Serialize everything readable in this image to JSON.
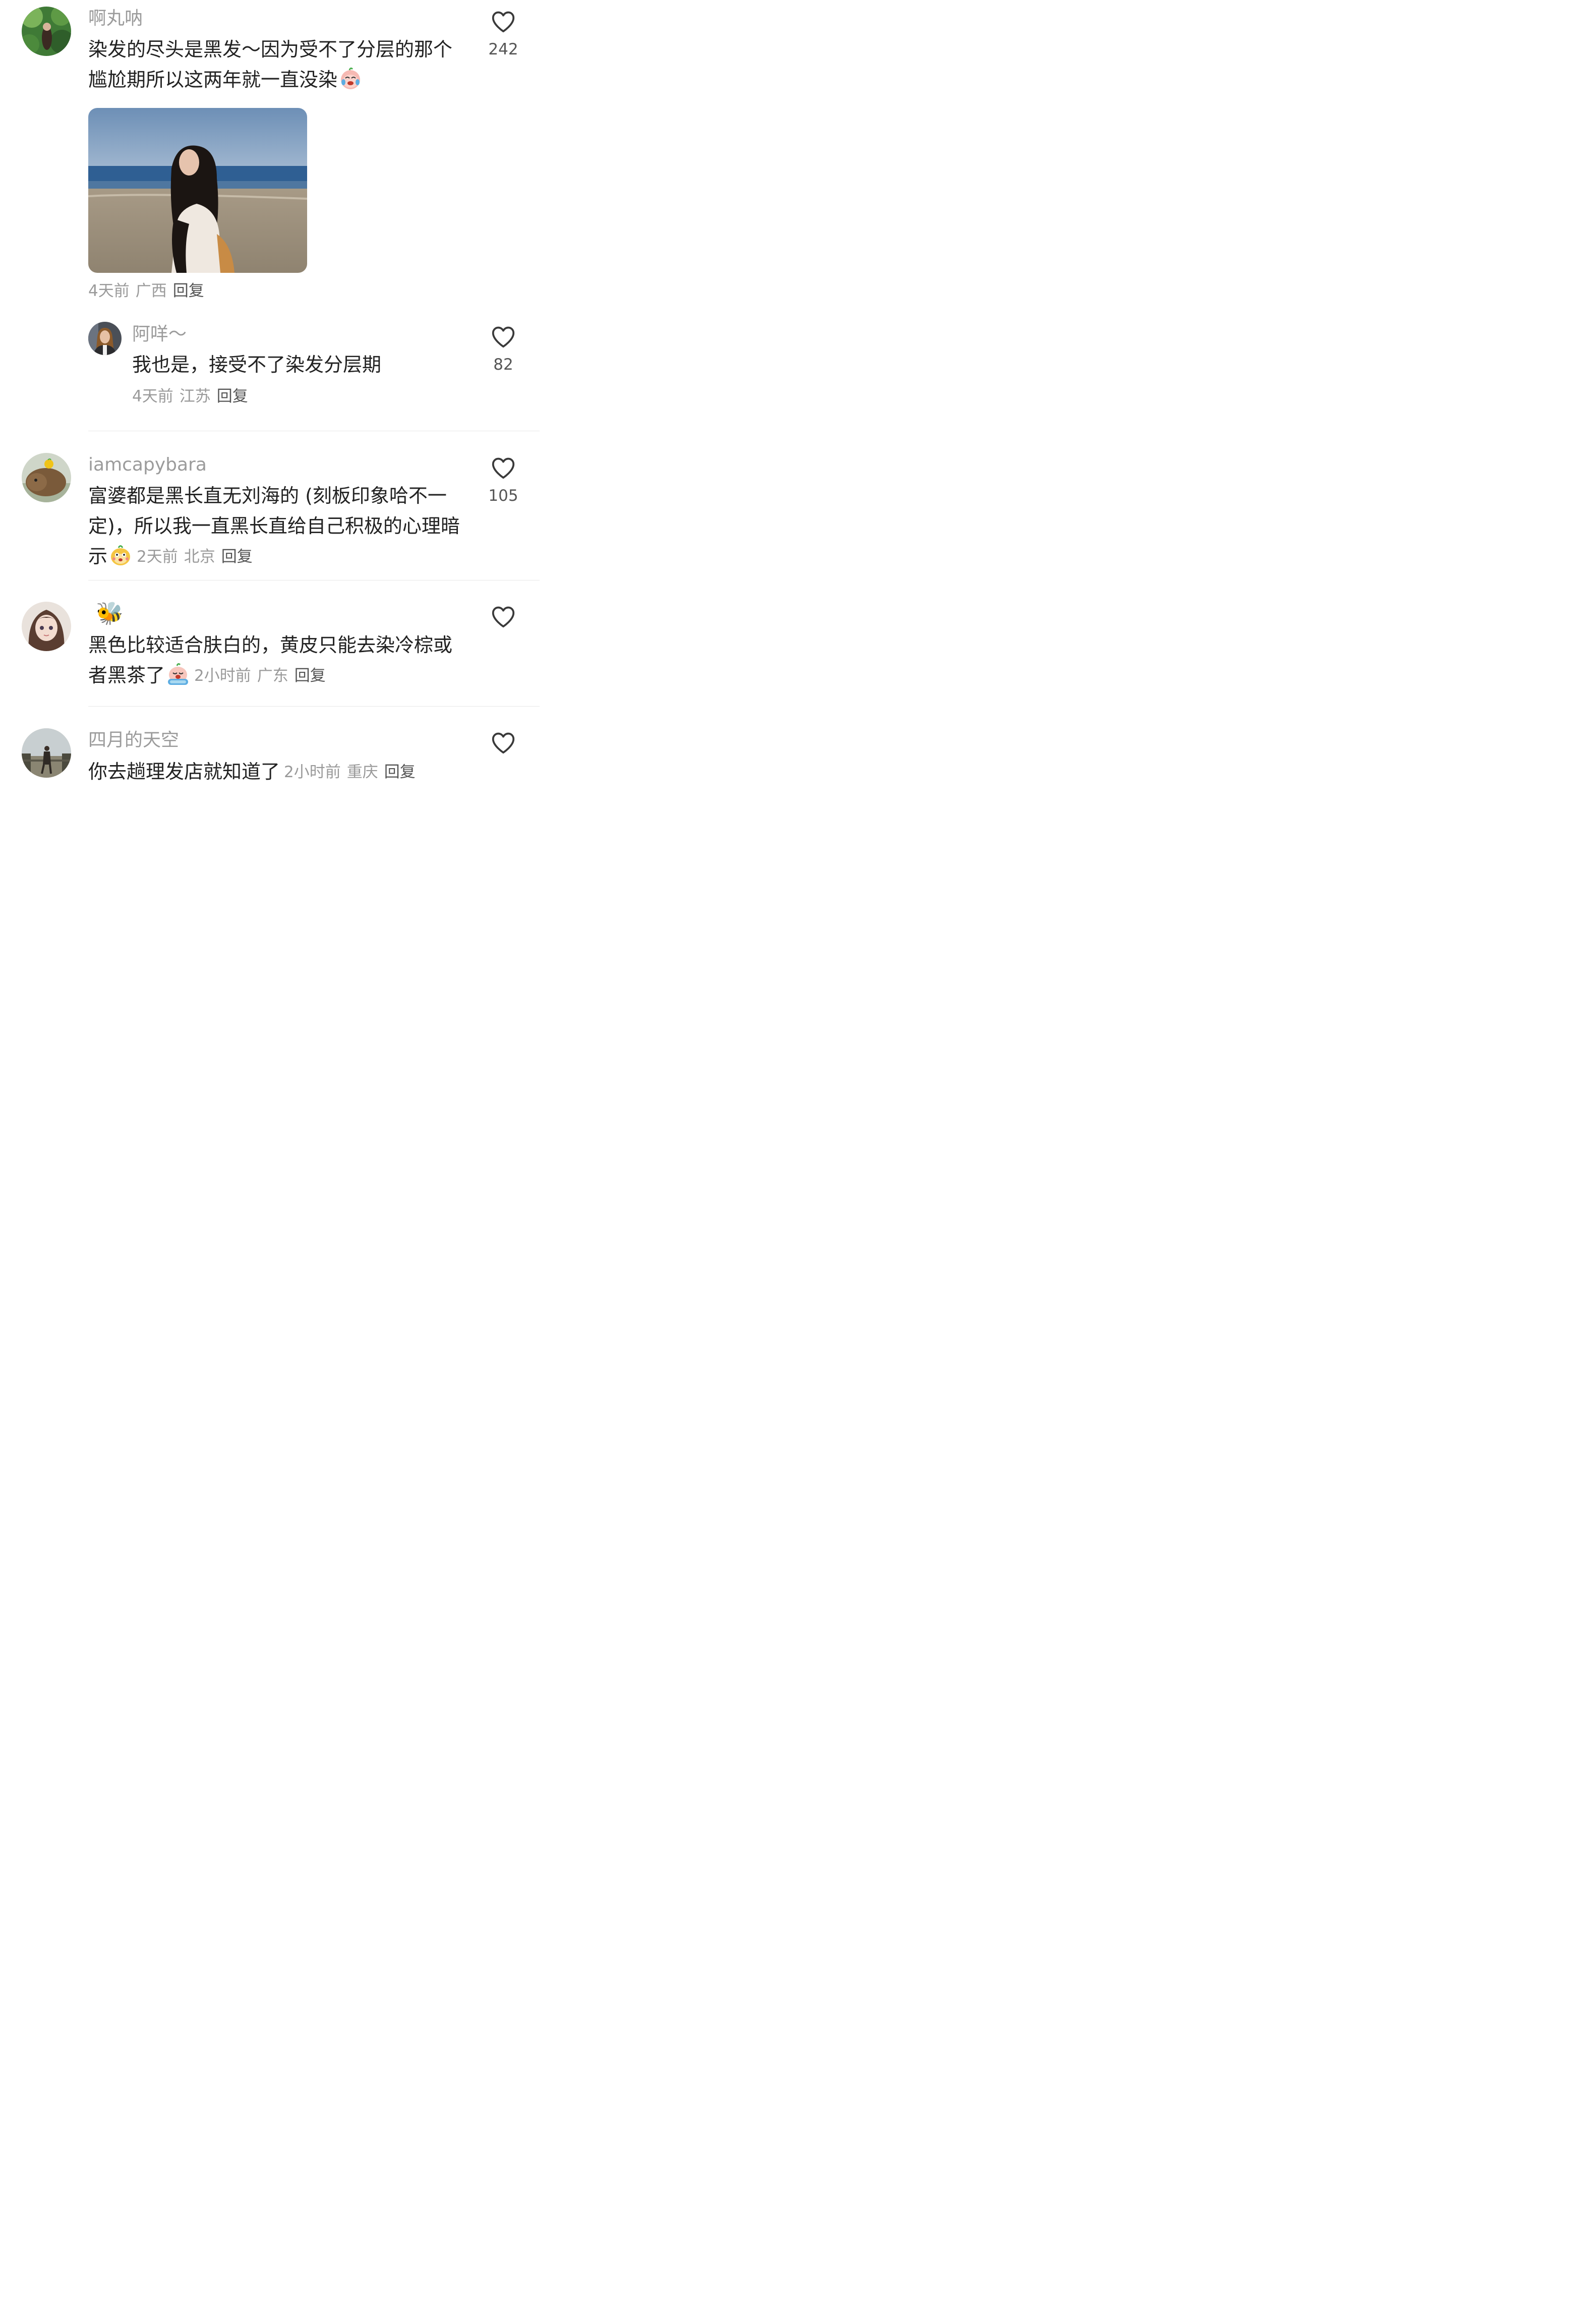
{
  "comments": [
    {
      "username": "啊丸呐",
      "text": "染发的尽头是黑发～因为受不了分层的那个尴尬期所以这两年就一直没染",
      "emoji": "crying-laughing-emoji",
      "time": "4天前",
      "location": "广西",
      "reply_label": "回复",
      "likes": "242",
      "replies": [
        {
          "username": "阿咩～",
          "text": "我也是，接受不了染发分层期",
          "time": "4天前",
          "location": "江苏",
          "reply_label": "回复",
          "likes": "82"
        }
      ]
    },
    {
      "username": "iamcapybara",
      "text": "富婆都是黑长直无刘海的 (刻板印象哈不一定)，所以我一直黑长直给自己积极的心理暗示",
      "emoji": "smug-face-emoji",
      "time": "2天前",
      "location": "北京",
      "reply_label": "回复",
      "likes": "105"
    },
    {
      "username": "🐝",
      "text": "黑色比较适合肤白的，黄皮只能去染冷棕或者黑茶了",
      "emoji": "sobbing-emoji",
      "time": "2小时前",
      "location": "广东",
      "reply_label": "回复",
      "likes": ""
    },
    {
      "username": "四月的天空",
      "text": "你去趟理发店就知道了",
      "time": "2小时前",
      "location": "重庆",
      "reply_label": "回复",
      "likes": ""
    }
  ],
  "colors": {
    "username": "#9b9b9b",
    "text": "#222222",
    "meta": "#9a9a9a",
    "reply": "#555555",
    "divider": "#e8e8e8"
  }
}
